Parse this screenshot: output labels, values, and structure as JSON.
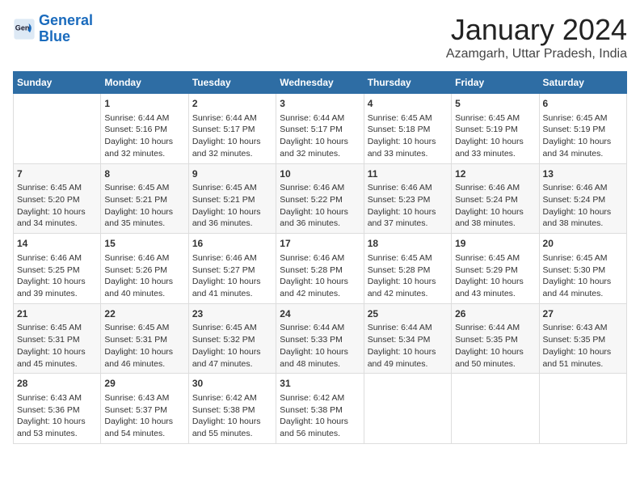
{
  "logo": {
    "line1": "General",
    "line2": "Blue"
  },
  "title": "January 2024",
  "location": "Azamgarh, Uttar Pradesh, India",
  "weekdays": [
    "Sunday",
    "Monday",
    "Tuesday",
    "Wednesday",
    "Thursday",
    "Friday",
    "Saturday"
  ],
  "weeks": [
    [
      {
        "day": "",
        "info": ""
      },
      {
        "day": "1",
        "info": "Sunrise: 6:44 AM\nSunset: 5:16 PM\nDaylight: 10 hours\nand 32 minutes."
      },
      {
        "day": "2",
        "info": "Sunrise: 6:44 AM\nSunset: 5:17 PM\nDaylight: 10 hours\nand 32 minutes."
      },
      {
        "day": "3",
        "info": "Sunrise: 6:44 AM\nSunset: 5:17 PM\nDaylight: 10 hours\nand 32 minutes."
      },
      {
        "day": "4",
        "info": "Sunrise: 6:45 AM\nSunset: 5:18 PM\nDaylight: 10 hours\nand 33 minutes."
      },
      {
        "day": "5",
        "info": "Sunrise: 6:45 AM\nSunset: 5:19 PM\nDaylight: 10 hours\nand 33 minutes."
      },
      {
        "day": "6",
        "info": "Sunrise: 6:45 AM\nSunset: 5:19 PM\nDaylight: 10 hours\nand 34 minutes."
      }
    ],
    [
      {
        "day": "7",
        "info": "Sunrise: 6:45 AM\nSunset: 5:20 PM\nDaylight: 10 hours\nand 34 minutes."
      },
      {
        "day": "8",
        "info": "Sunrise: 6:45 AM\nSunset: 5:21 PM\nDaylight: 10 hours\nand 35 minutes."
      },
      {
        "day": "9",
        "info": "Sunrise: 6:45 AM\nSunset: 5:21 PM\nDaylight: 10 hours\nand 36 minutes."
      },
      {
        "day": "10",
        "info": "Sunrise: 6:46 AM\nSunset: 5:22 PM\nDaylight: 10 hours\nand 36 minutes."
      },
      {
        "day": "11",
        "info": "Sunrise: 6:46 AM\nSunset: 5:23 PM\nDaylight: 10 hours\nand 37 minutes."
      },
      {
        "day": "12",
        "info": "Sunrise: 6:46 AM\nSunset: 5:24 PM\nDaylight: 10 hours\nand 38 minutes."
      },
      {
        "day": "13",
        "info": "Sunrise: 6:46 AM\nSunset: 5:24 PM\nDaylight: 10 hours\nand 38 minutes."
      }
    ],
    [
      {
        "day": "14",
        "info": "Sunrise: 6:46 AM\nSunset: 5:25 PM\nDaylight: 10 hours\nand 39 minutes."
      },
      {
        "day": "15",
        "info": "Sunrise: 6:46 AM\nSunset: 5:26 PM\nDaylight: 10 hours\nand 40 minutes."
      },
      {
        "day": "16",
        "info": "Sunrise: 6:46 AM\nSunset: 5:27 PM\nDaylight: 10 hours\nand 41 minutes."
      },
      {
        "day": "17",
        "info": "Sunrise: 6:46 AM\nSunset: 5:28 PM\nDaylight: 10 hours\nand 42 minutes."
      },
      {
        "day": "18",
        "info": "Sunrise: 6:45 AM\nSunset: 5:28 PM\nDaylight: 10 hours\nand 42 minutes."
      },
      {
        "day": "19",
        "info": "Sunrise: 6:45 AM\nSunset: 5:29 PM\nDaylight: 10 hours\nand 43 minutes."
      },
      {
        "day": "20",
        "info": "Sunrise: 6:45 AM\nSunset: 5:30 PM\nDaylight: 10 hours\nand 44 minutes."
      }
    ],
    [
      {
        "day": "21",
        "info": "Sunrise: 6:45 AM\nSunset: 5:31 PM\nDaylight: 10 hours\nand 45 minutes."
      },
      {
        "day": "22",
        "info": "Sunrise: 6:45 AM\nSunset: 5:31 PM\nDaylight: 10 hours\nand 46 minutes."
      },
      {
        "day": "23",
        "info": "Sunrise: 6:45 AM\nSunset: 5:32 PM\nDaylight: 10 hours\nand 47 minutes."
      },
      {
        "day": "24",
        "info": "Sunrise: 6:44 AM\nSunset: 5:33 PM\nDaylight: 10 hours\nand 48 minutes."
      },
      {
        "day": "25",
        "info": "Sunrise: 6:44 AM\nSunset: 5:34 PM\nDaylight: 10 hours\nand 49 minutes."
      },
      {
        "day": "26",
        "info": "Sunrise: 6:44 AM\nSunset: 5:35 PM\nDaylight: 10 hours\nand 50 minutes."
      },
      {
        "day": "27",
        "info": "Sunrise: 6:43 AM\nSunset: 5:35 PM\nDaylight: 10 hours\nand 51 minutes."
      }
    ],
    [
      {
        "day": "28",
        "info": "Sunrise: 6:43 AM\nSunset: 5:36 PM\nDaylight: 10 hours\nand 53 minutes."
      },
      {
        "day": "29",
        "info": "Sunrise: 6:43 AM\nSunset: 5:37 PM\nDaylight: 10 hours\nand 54 minutes."
      },
      {
        "day": "30",
        "info": "Sunrise: 6:42 AM\nSunset: 5:38 PM\nDaylight: 10 hours\nand 55 minutes."
      },
      {
        "day": "31",
        "info": "Sunrise: 6:42 AM\nSunset: 5:38 PM\nDaylight: 10 hours\nand 56 minutes."
      },
      {
        "day": "",
        "info": ""
      },
      {
        "day": "",
        "info": ""
      },
      {
        "day": "",
        "info": ""
      }
    ]
  ]
}
